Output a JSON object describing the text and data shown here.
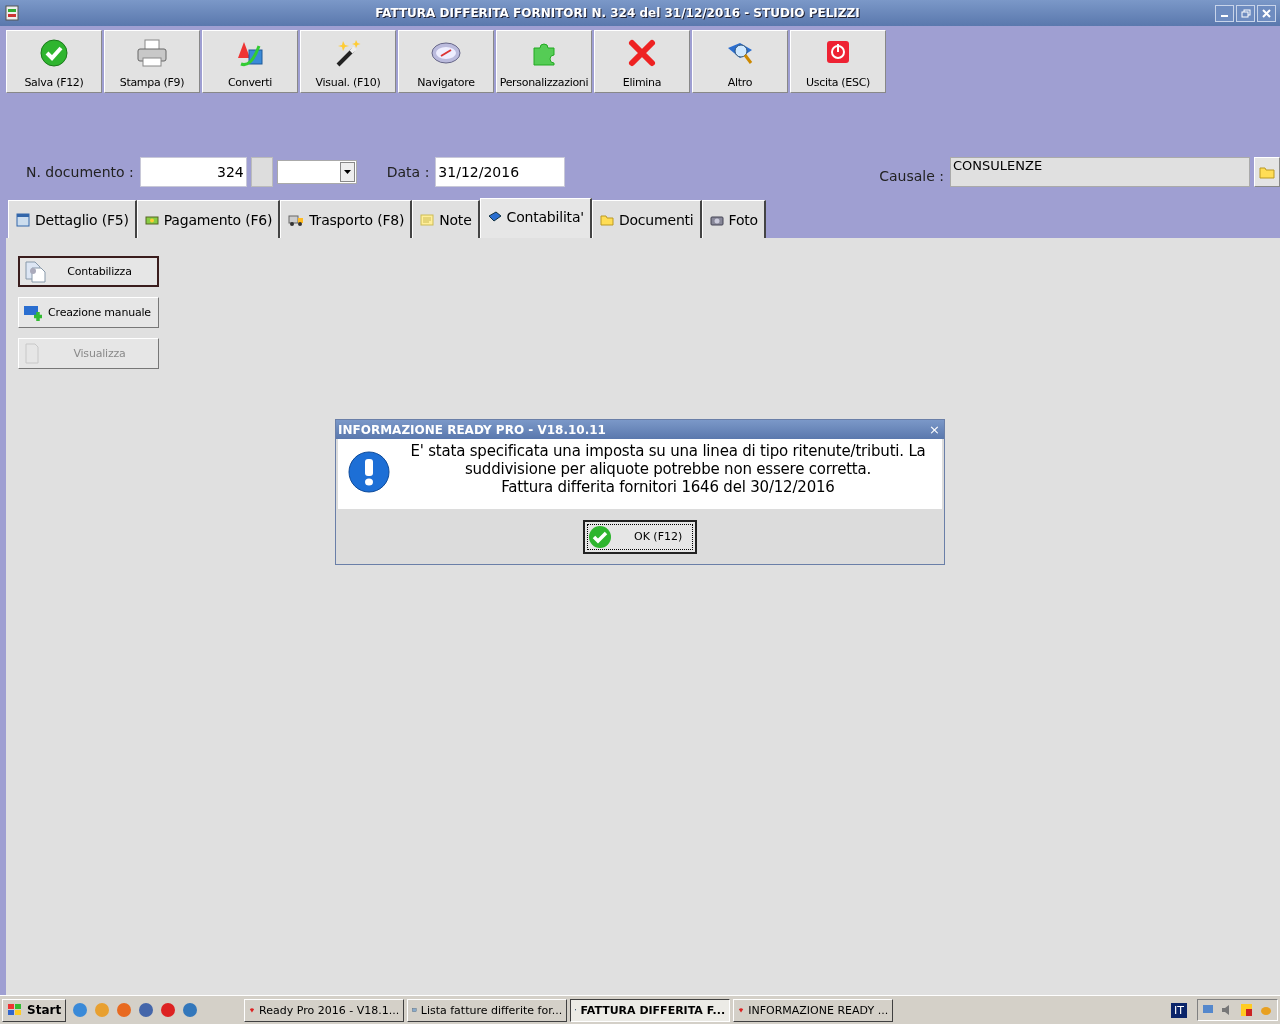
{
  "window": {
    "title": "FATTURA DIFFERITA FORNITORI N. 324 del 31/12/2016 - STUDIO PELIZZI"
  },
  "toolbar": [
    {
      "label": "Salva (F12)"
    },
    {
      "label": "Stampa (F9)"
    },
    {
      "label": "Converti"
    },
    {
      "label": "Visual. (F10)"
    },
    {
      "label": "Navigatore"
    },
    {
      "label": "Personalizzazioni"
    },
    {
      "label": "Elimina"
    },
    {
      "label": "Altro"
    },
    {
      "label": "Uscita (ESC)"
    }
  ],
  "form": {
    "doc_label": "N. documento :",
    "doc_value": "324",
    "date_label": "Data :",
    "date_value": "31/12/2016",
    "causale_label": "Causale :",
    "causale_value": "CONSULENZE"
  },
  "tabs": [
    {
      "label": "Dettaglio (F5)",
      "selected": false
    },
    {
      "label": "Pagamento (F6)",
      "selected": false
    },
    {
      "label": "Trasporto (F8)",
      "selected": false
    },
    {
      "label": "Note",
      "selected": false
    },
    {
      "label": "Contabilita'",
      "selected": true
    },
    {
      "label": "Documenti",
      "selected": false
    },
    {
      "label": "Foto",
      "selected": false
    }
  ],
  "actions": [
    {
      "label": "Contabilizza",
      "disabled": false,
      "focused": true
    },
    {
      "label": "Creazione manuale",
      "disabled": false,
      "focused": false
    },
    {
      "label": "Visualizza",
      "disabled": true,
      "focused": false
    }
  ],
  "dialog": {
    "title": "INFORMAZIONE READY PRO - V18.10.11",
    "close": "×",
    "message": [
      "E' stata specificata una imposta su una linea di tipo ritenute/tributi. La",
      "suddivisione per aliquote potrebbe non essere corretta.",
      "Fattura differita fornitori 1646 del 30/12/2016"
    ],
    "button": "OK (F12)"
  },
  "taskbar": {
    "start": "Start",
    "tasks": [
      {
        "label": "Ready Pro 2016 - V18.1...",
        "selected": false
      },
      {
        "label": "Lista fatture differite for...",
        "selected": false
      },
      {
        "label": "FATTURA DIFFERITA F...",
        "selected": true
      },
      {
        "label": "INFORMAZIONE READY ...",
        "selected": false
      }
    ],
    "language": "IT"
  }
}
